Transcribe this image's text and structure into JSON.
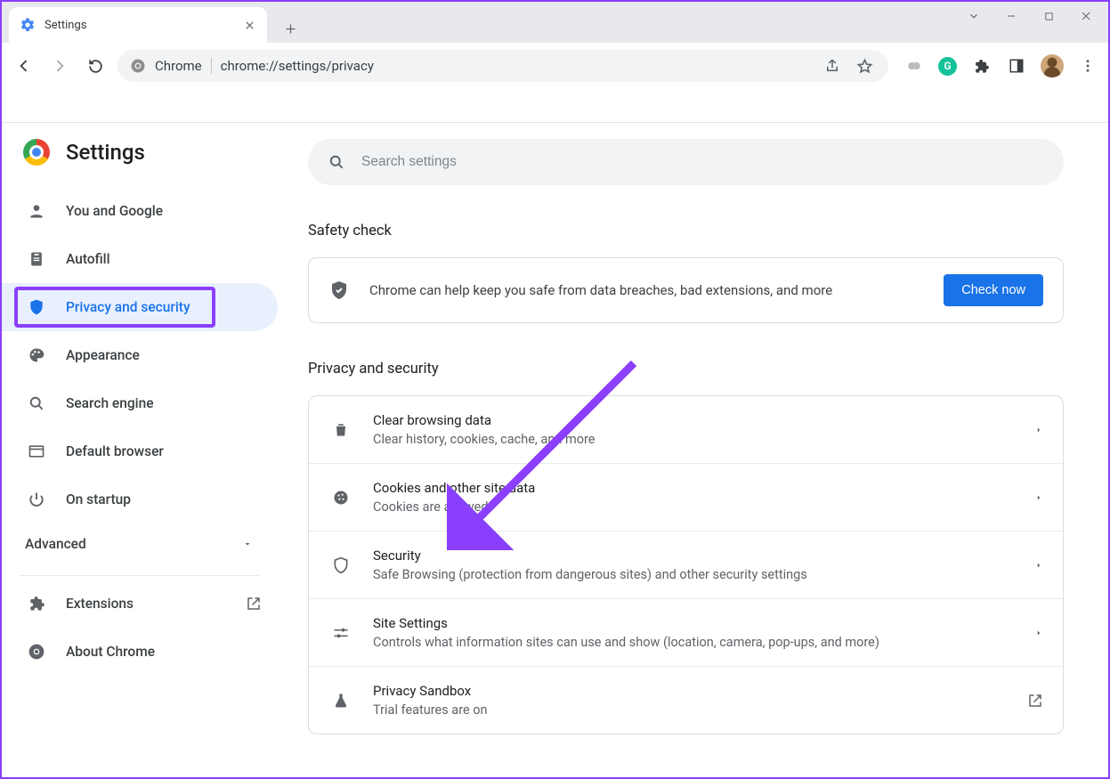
{
  "tab": {
    "title": "Settings"
  },
  "omnibox": {
    "host_label": "Chrome",
    "url": "chrome://settings/privacy"
  },
  "page": {
    "title": "Settings",
    "search_placeholder": "Search settings",
    "advanced_label": "Advanced"
  },
  "sidebar": {
    "items": [
      {
        "label": "You and Google"
      },
      {
        "label": "Autofill"
      },
      {
        "label": "Privacy and security"
      },
      {
        "label": "Appearance"
      },
      {
        "label": "Search engine"
      },
      {
        "label": "Default browser"
      },
      {
        "label": "On startup"
      }
    ],
    "extensions_label": "Extensions",
    "about_label": "About Chrome"
  },
  "safety_check": {
    "heading": "Safety check",
    "text": "Chrome can help keep you safe from data breaches, bad extensions, and more",
    "button": "Check now"
  },
  "privacy": {
    "heading": "Privacy and security",
    "rows": [
      {
        "title": "Clear browsing data",
        "sub": "Clear history, cookies, cache, and more"
      },
      {
        "title": "Cookies and other site data",
        "sub": "Cookies are allowed"
      },
      {
        "title": "Security",
        "sub": "Safe Browsing (protection from dangerous sites) and other security settings"
      },
      {
        "title": "Site Settings",
        "sub": "Controls what information sites can use and show (location, camera, pop-ups, and more)"
      },
      {
        "title": "Privacy Sandbox",
        "sub": "Trial features are on"
      }
    ]
  }
}
